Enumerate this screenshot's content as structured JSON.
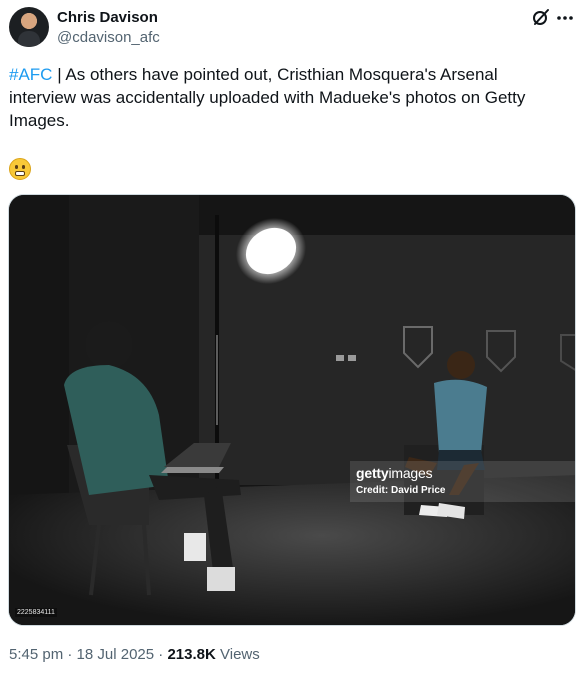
{
  "author": {
    "display_name": "Chris Davison",
    "handle": "@cdavison_afc"
  },
  "icons": {
    "grok": "grok-icon",
    "more": "more-options-icon",
    "emoji": "grimacing-face"
  },
  "tweet": {
    "hashtag": "#AFC",
    "body": " | As others have pointed out, Cristhian Mosquera's Arsenal interview was accidentally uploaded with Madueke's photos on Getty Images."
  },
  "photo": {
    "watermark_brand_bold": "getty",
    "watermark_brand_thin": "images",
    "watermark_credit": "Credit: David Price",
    "image_id": "2225834111"
  },
  "meta": {
    "time": "5:45 pm",
    "separator": " · ",
    "date": "18 Jul 2025",
    "views_count": "213.8K",
    "views_label": " Views"
  },
  "colors": {
    "link": "#1d9bf0",
    "secondary_text": "#536471",
    "primary_text": "#0f1419"
  }
}
